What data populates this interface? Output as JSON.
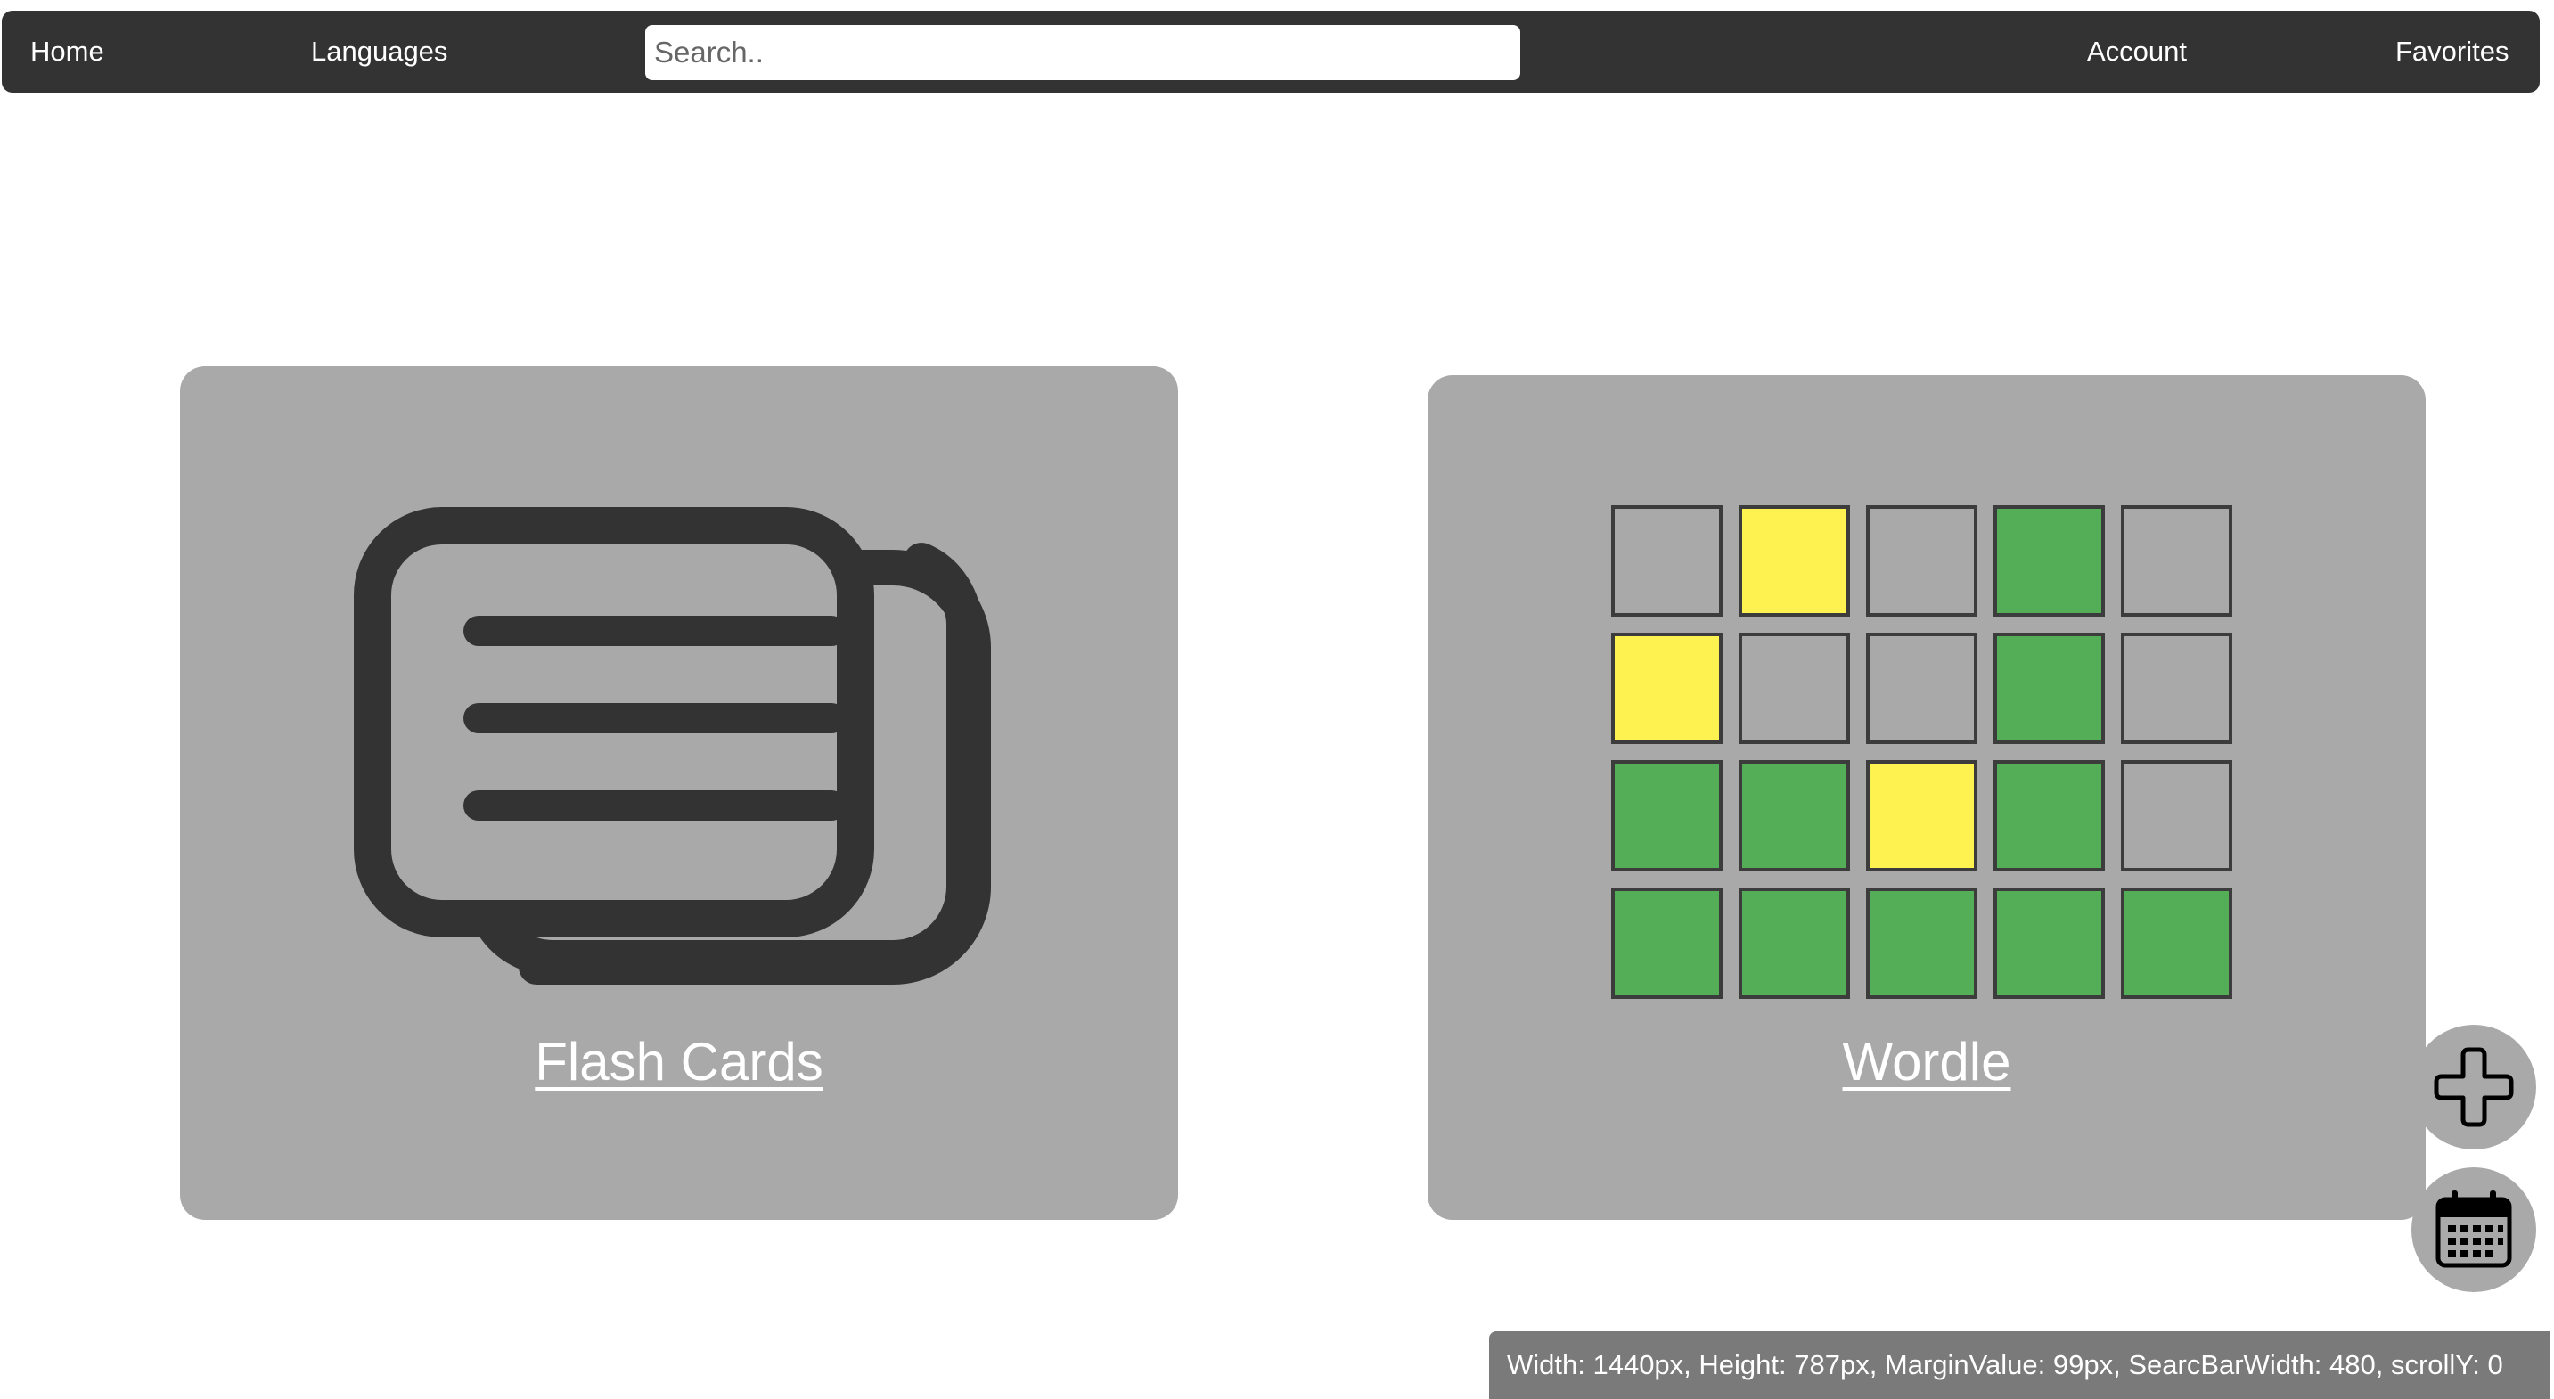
{
  "nav": {
    "home": "Home",
    "languages": "Languages",
    "search_placeholder": "Search..",
    "search_value": "",
    "account": "Account",
    "favorites": "Favorites"
  },
  "cards": {
    "flash_cards": {
      "title": "Flash Cards",
      "icon": "flash-cards-icon"
    },
    "wordle": {
      "title": "Wordle",
      "icon": "wordle-grid-icon"
    }
  },
  "wordle_grid": {
    "colors": {
      "empty": "#a9a9a9",
      "present": "#fdf250",
      "correct": "#54ad57"
    },
    "rows": [
      [
        "empty",
        "present",
        "empty",
        "correct",
        "empty"
      ],
      [
        "present",
        "empty",
        "empty",
        "correct",
        "empty"
      ],
      [
        "correct",
        "correct",
        "present",
        "correct",
        "empty"
      ],
      [
        "correct",
        "correct",
        "correct",
        "correct",
        "correct"
      ]
    ]
  },
  "fabs": {
    "add_icon": "plus-icon",
    "calendar_icon": "calendar-icon"
  },
  "debug_bar": {
    "text": "Width: 1440px, Height: 787px, MarginValue: 99px, SearcBarWidth: 480, scrollY: 0"
  },
  "colors": {
    "navbar": "#333333",
    "card": "#a9a9a9",
    "icon_stroke": "#333333"
  }
}
